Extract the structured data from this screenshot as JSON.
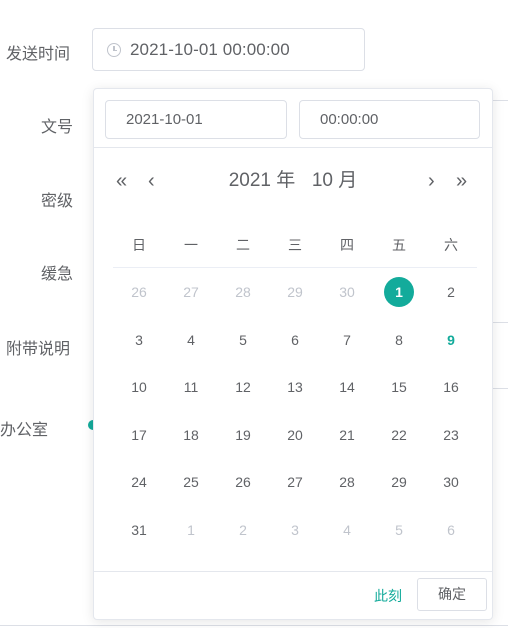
{
  "form": {
    "labels": {
      "send_time": "发送时间",
      "doc_number": "文号",
      "secret_level": "密级",
      "urgency": "缓急",
      "notes": "附带说明",
      "office": "办公室"
    },
    "send_time_value": "2021-10-01 00:00:00"
  },
  "picker": {
    "date_input": "2021-10-01",
    "time_input": "00:00:00",
    "year_label": "2021 年",
    "month_label": "10 月",
    "nav": {
      "prev_year": "«",
      "prev_month": "‹",
      "next_month": "›",
      "next_year": "»"
    },
    "weekdays": [
      "日",
      "一",
      "二",
      "三",
      "四",
      "五",
      "六"
    ],
    "weeks": [
      [
        {
          "d": "26",
          "t": "other"
        },
        {
          "d": "27",
          "t": "other"
        },
        {
          "d": "28",
          "t": "other"
        },
        {
          "d": "29",
          "t": "other"
        },
        {
          "d": "30",
          "t": "other"
        },
        {
          "d": "1",
          "t": "selected"
        },
        {
          "d": "2",
          "t": "cur"
        }
      ],
      [
        {
          "d": "3",
          "t": "cur"
        },
        {
          "d": "4",
          "t": "cur"
        },
        {
          "d": "5",
          "t": "cur"
        },
        {
          "d": "6",
          "t": "cur"
        },
        {
          "d": "7",
          "t": "cur"
        },
        {
          "d": "8",
          "t": "cur"
        },
        {
          "d": "9",
          "t": "today"
        }
      ],
      [
        {
          "d": "10",
          "t": "cur"
        },
        {
          "d": "11",
          "t": "cur"
        },
        {
          "d": "12",
          "t": "cur"
        },
        {
          "d": "13",
          "t": "cur"
        },
        {
          "d": "14",
          "t": "cur"
        },
        {
          "d": "15",
          "t": "cur"
        },
        {
          "d": "16",
          "t": "cur"
        }
      ],
      [
        {
          "d": "17",
          "t": "cur"
        },
        {
          "d": "18",
          "t": "cur"
        },
        {
          "d": "19",
          "t": "cur"
        },
        {
          "d": "20",
          "t": "cur"
        },
        {
          "d": "21",
          "t": "cur"
        },
        {
          "d": "22",
          "t": "cur"
        },
        {
          "d": "23",
          "t": "cur"
        }
      ],
      [
        {
          "d": "24",
          "t": "cur"
        },
        {
          "d": "25",
          "t": "cur"
        },
        {
          "d": "26",
          "t": "cur"
        },
        {
          "d": "27",
          "t": "cur"
        },
        {
          "d": "28",
          "t": "cur"
        },
        {
          "d": "29",
          "t": "cur"
        },
        {
          "d": "30",
          "t": "cur"
        }
      ],
      [
        {
          "d": "31",
          "t": "cur"
        },
        {
          "d": "1",
          "t": "other"
        },
        {
          "d": "2",
          "t": "other"
        },
        {
          "d": "3",
          "t": "other"
        },
        {
          "d": "4",
          "t": "other"
        },
        {
          "d": "5",
          "t": "other"
        },
        {
          "d": "6",
          "t": "other"
        }
      ]
    ],
    "now_label": "此刻",
    "confirm_label": "确定",
    "icons": {
      "time_input": "clock-icon"
    },
    "colors": {
      "accent": "#13ab9b",
      "text": "#606266",
      "muted": "#c0c4cc"
    }
  }
}
